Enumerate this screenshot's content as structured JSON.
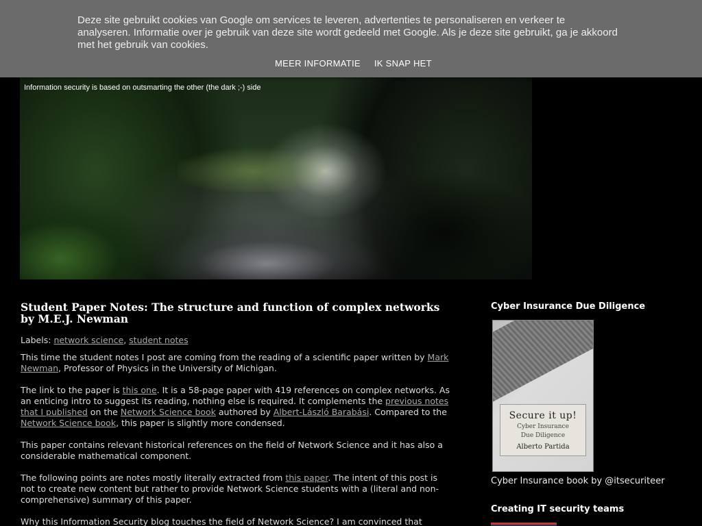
{
  "cookie_bar": {
    "text": "Deze site gebruikt cookies van Google om services te leveren, advertenties te personaliseren en verkeer te analyseren. Informatie over je gebruik van deze site wordt gedeeld met Google. Als je deze site gebruikt, ga je akkoord met het gebruik van cookies.",
    "more_info_label": "MEER INFORMATIE",
    "accept_label": "IK SNAP HET",
    "background_color": "#6b6b6b"
  },
  "header": {
    "tagline": "Information security is based on outsmarting the other (the dark ;-) side"
  },
  "post": {
    "title": "Student Paper Notes: The structure and function of complex networks by M.E.J. Newman",
    "labels_prefix": "Labels:",
    "labels": [
      "network science",
      "student notes"
    ],
    "p1": {
      "t1": "This time the student notes I post are coming from the reading of a scientific paper written by ",
      "link1": "Mark Newman",
      "t2": ", Professor of Physics in the University of Michigan."
    },
    "p2": {
      "t1": "The link to the paper is ",
      "link1": "this one",
      "t2": ". It is a 58-page paper with 419 references on complex networks. As an enticing intro to suggest its reading, nothing else is required. It complements the ",
      "link2": "previous notes that I published",
      "t3": " on the ",
      "link3": "Network Science book",
      "t4": " authored by ",
      "link4": "Albert-László Barabási",
      "t5": ". Compared to the ",
      "link5": "Network Science book",
      "t6": ", this paper is slightly more condensed."
    },
    "p3": "This paper contains relevant historical references on the field of Network Science and it has also a considerable mathematical component.",
    "p4": {
      "t1": "The following points are notes mostly literally extracted from ",
      "link1": "this paper",
      "t2": ". The intent of this post is not to create new content but rather to provide Network Science students with a (literal and non-comprehensive) summary of this paper."
    },
    "p5": "Why this Information Security blog touches the field of Network Science? I am convinced that"
  },
  "sidebar": {
    "widget1": {
      "title": "Cyber Insurance Due Diligence",
      "cover_title": "Secure it up!",
      "cover_subtitle_1": "Cyber Insurance",
      "cover_subtitle_2": "Due Diligence",
      "cover_author": "Alberto Partida",
      "caption": "Cyber Insurance book by @itsecuriteer"
    },
    "widget2": {
      "title": "Creating IT security teams"
    }
  }
}
